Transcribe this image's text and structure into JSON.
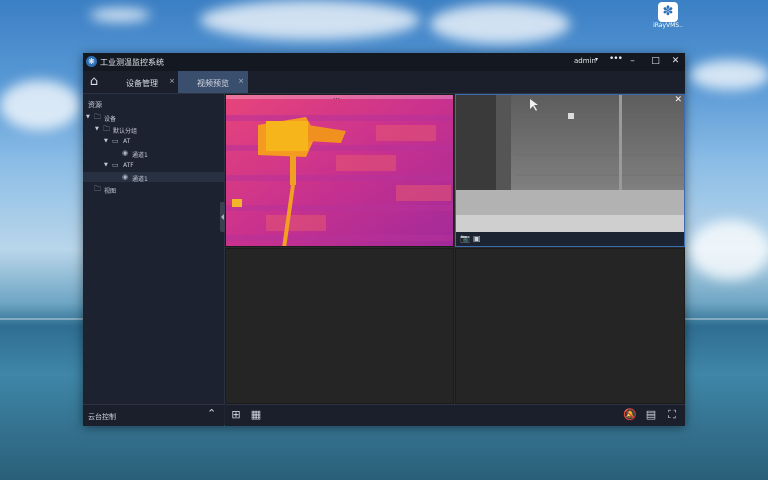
{
  "desktop": {
    "icon_label": "iRayVMS..",
    "icon_glyph": "✽"
  },
  "app": {
    "title": "工业测温监控系统",
    "logo_glyph": "❋",
    "user": "admin",
    "user_caret": "▾",
    "more": "•••",
    "window_buttons": {
      "minimize": "–",
      "maximize": "□",
      "close": "✕"
    }
  },
  "tabs": {
    "home_glyph": "⌂",
    "items": [
      {
        "label": "设备管理",
        "close": "×"
      },
      {
        "label": "视频预览",
        "close": "×"
      }
    ]
  },
  "sidebar": {
    "title": "资源",
    "tree": [
      {
        "label": "设备",
        "arrow": "▼",
        "icon": "folder-icon"
      },
      {
        "label": "默认分组",
        "arrow": "▼",
        "icon": "folder-icon"
      },
      {
        "label": "AT",
        "arrow": "▼",
        "icon": "camera-icon"
      },
      {
        "label": "通道1",
        "arrow": "",
        "icon": "channel-icon"
      },
      {
        "label": "ATF",
        "arrow": "▼",
        "icon": "camera-icon"
      },
      {
        "label": "通道1",
        "arrow": "",
        "icon": "channel-icon"
      },
      {
        "label": "视图",
        "arrow": "",
        "icon": "folder-icon"
      }
    ],
    "ptz": {
      "label": "云台控制",
      "chevron": "⌃"
    }
  },
  "video": {
    "cell1_osd": "…",
    "cell2_osd": "…",
    "cell_close": "✕",
    "cell_toolbar": {
      "snapshot": "📷",
      "record": "▣"
    }
  },
  "bottom_toolbar": {
    "layout_icon": "layout-icon",
    "layout_add_icon": "layout-add-icon",
    "mute_icon": "alarm-off-icon",
    "grid_settings_icon": "grid-settings-icon",
    "fullscreen_icon": "fullscreen-icon"
  },
  "colors": {
    "accent": "#3a4f6e",
    "titlebar": "#141821",
    "panel": "#1c2230"
  }
}
